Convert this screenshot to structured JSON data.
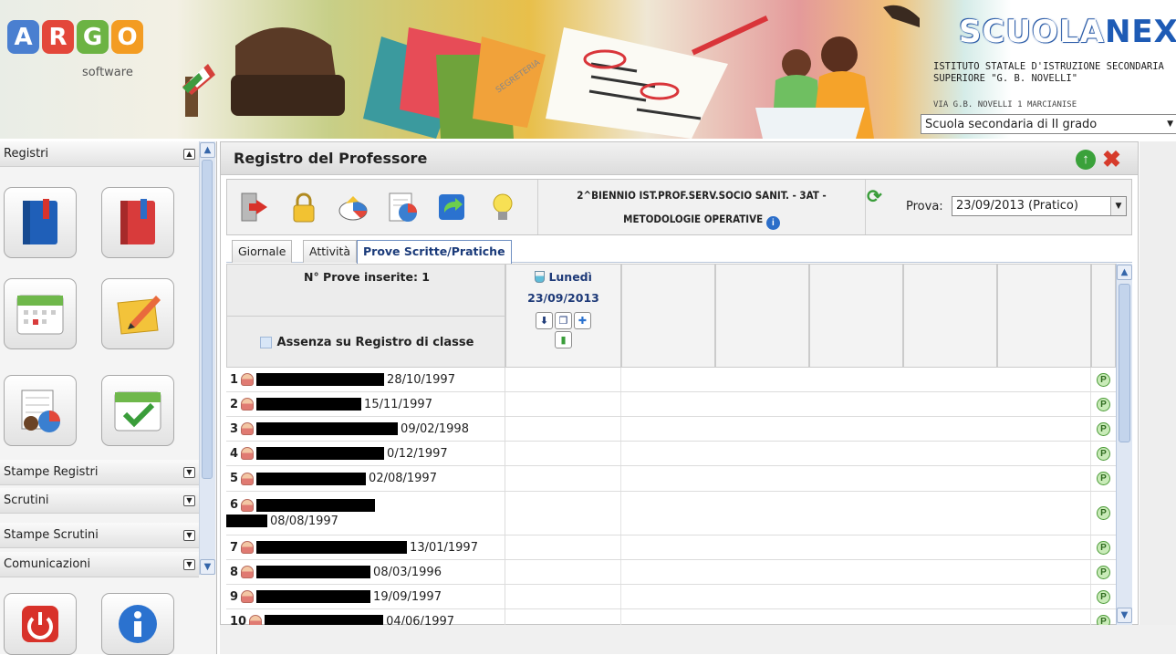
{
  "header": {
    "logo_letters": [
      "A",
      "R",
      "G",
      "O"
    ],
    "logo_colors": [
      "#4a7fd0",
      "#e3473a",
      "#6cb343",
      "#f39c22"
    ],
    "logo_subtitle": "software",
    "brand_part1": "SCUOLA",
    "brand_part2": "NEXT",
    "school_name": "ISTITUTO STATALE D'ISTRUZIONE SECONDARIA SUPERIORE \"G. B. NOVELLI\"",
    "school_address": "VIA G.B. NOVELLI 1 MARCIANISE",
    "school_type": "Scuola secondaria di II grado"
  },
  "sidebar": {
    "section_registri": "Registri",
    "section_stampe_registri": "Stampe Registri",
    "section_scrutini": "Scrutini",
    "section_stampe_scrutini": "Stampe Scrutini",
    "section_comunicazioni": "Comunicazioni"
  },
  "main": {
    "title": "Registro del Professore",
    "class_line": "2^BIENNIO IST.PROF.SERV.SOCIO SANIT. - 3AT -",
    "subject_line": "METODOLOGIE OPERATIVE",
    "prova_label": "Prova:",
    "prova_value": "23/09/2013 (Pratico)",
    "tabs": [
      "Giornale",
      "Attività",
      "Prove Scritte/Pratiche"
    ],
    "prove_count": "N° Prove inserite: 1",
    "assenza_label": "Assenza su Registro di classe",
    "date_day": "Lunedì",
    "date_value": "23/09/2013",
    "status_badge": "P"
  },
  "students": [
    {
      "n": "1",
      "date": "28/10/1997"
    },
    {
      "n": "2",
      "date": "15/11/1997"
    },
    {
      "n": "3",
      "date": "09/02/1998"
    },
    {
      "n": "4",
      "date": "0/12/1997"
    },
    {
      "n": "5",
      "date": "02/08/1997"
    },
    {
      "n": "6",
      "date": "08/08/1997"
    },
    {
      "n": "7",
      "date": "13/01/1997"
    },
    {
      "n": "8",
      "date": "08/03/1996"
    },
    {
      "n": "9",
      "date": "19/09/1997"
    },
    {
      "n": "10",
      "date": "04/06/1997"
    }
  ]
}
